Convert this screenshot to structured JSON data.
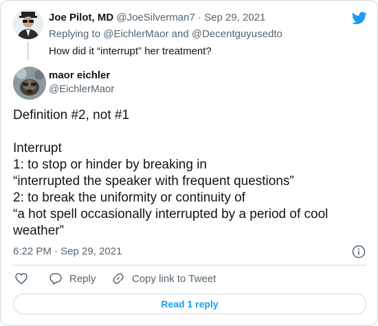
{
  "parent": {
    "name": "Joe Pilot, MD",
    "handle": "@JoeSilverman7",
    "separator": "·",
    "date": "Sep 29, 2021",
    "replying_prefix": "Replying to",
    "replying_user1": "@EichlerMaor",
    "replying_and": "and",
    "replying_user2": "@Decentguyusedto",
    "text": "How did it “interrupt” her treatment?"
  },
  "main": {
    "name": "maor eichler",
    "handle": "@EichlerMaor",
    "body_lines": [
      "Definition #2, not #1",
      "",
      "Interrupt",
      "1: to stop or hinder by breaking in",
      "“interrupted the speaker with frequent questions”",
      "2: to break the uniformity or continuity of",
      "“a hot spell occasionally interrupted by a period of cool",
      "weather”"
    ],
    "timestamp": "6:22 PM · Sep 29, 2021"
  },
  "actions": {
    "reply_label": "Reply",
    "copy_label": "Copy link to Tweet"
  },
  "read_replies_label": "Read 1 reply",
  "icons": {
    "logo": "twitter-bird-icon",
    "info": "info-icon",
    "like": "heart-icon",
    "reply": "speech-bubble-icon",
    "copy": "link-icon"
  },
  "colors": {
    "brand": "#1d9bf0",
    "text": "#0f1419",
    "muted": "#536471",
    "border": "#cfd9de"
  }
}
